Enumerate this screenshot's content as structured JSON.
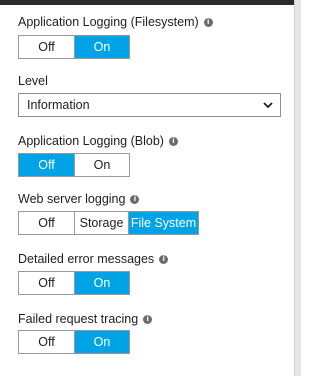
{
  "sections": {
    "app_fs": {
      "label": "Application Logging (Filesystem)",
      "options": [
        "Off",
        "On"
      ],
      "selected": "On"
    },
    "level": {
      "label": "Level",
      "value": "Information"
    },
    "app_blob": {
      "label": "Application Logging (Blob)",
      "options": [
        "Off",
        "On"
      ],
      "selected": "Off"
    },
    "web_server": {
      "label": "Web server logging",
      "options": [
        "Off",
        "Storage",
        "File System"
      ],
      "selected": "File System"
    },
    "detailed_errors": {
      "label": "Detailed error messages",
      "options": [
        "Off",
        "On"
      ],
      "selected": "On"
    },
    "failed_request": {
      "label": "Failed request tracing",
      "options": [
        "Off",
        "On"
      ],
      "selected": "On"
    }
  },
  "icons": {
    "info": "info-icon",
    "chevron": "chevron-down-icon"
  },
  "colors": {
    "accent": "#00a3e6",
    "top_bar": "#2b2b2b"
  }
}
